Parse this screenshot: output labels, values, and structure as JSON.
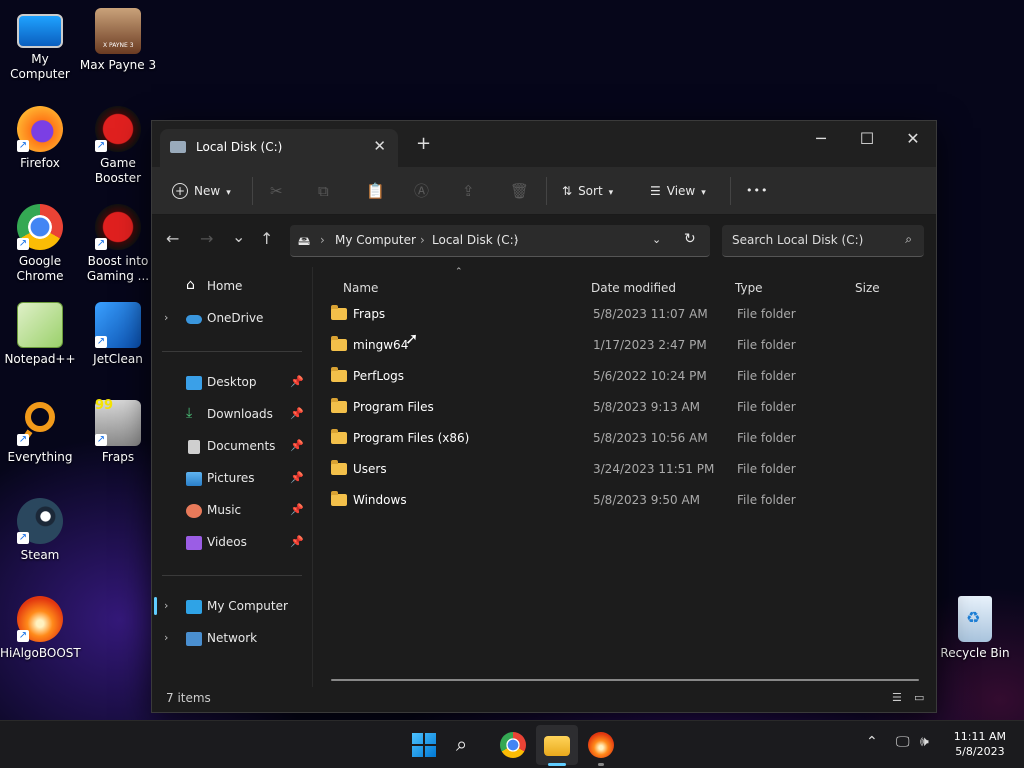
{
  "desktop": {
    "icons": [
      {
        "label": "My Computer",
        "icon": "monitor-icon"
      },
      {
        "label": "Max Payne 3",
        "icon": "game-cover-icon"
      },
      {
        "label": "Firefox",
        "icon": "firefox-icon"
      },
      {
        "label": "Game Booster",
        "icon": "game-booster-icon"
      },
      {
        "label": "Google Chrome",
        "icon": "chrome-icon"
      },
      {
        "label": "Boost into Gaming ...",
        "icon": "game-booster-icon"
      },
      {
        "label": "Notepad++",
        "icon": "notepad-icon"
      },
      {
        "label": "JetClean",
        "icon": "jetclean-icon"
      },
      {
        "label": "Everything",
        "icon": "search-icon"
      },
      {
        "label": "Fraps",
        "icon": "fraps-icon"
      },
      {
        "label": "Steam",
        "icon": "steam-icon"
      },
      {
        "label": "HiAlgoBOOST",
        "icon": "flame-icon"
      },
      {
        "label": "Recycle Bin",
        "icon": "recycle-bin-icon"
      }
    ],
    "max_payne_badge": "X PAYNE 3",
    "fraps_badge": "99"
  },
  "window": {
    "tab_title": "Local Disk (C:)",
    "tab_close": "✕",
    "new_tab": "+",
    "minimize": "─",
    "maximize": "☐",
    "close": "✕"
  },
  "toolbar": {
    "new_label": "New",
    "sort_label": "Sort",
    "view_label": "View",
    "more": "•••"
  },
  "nav": {
    "back": "←",
    "forward": "→",
    "recent": "⌄",
    "up": "↑",
    "breadcrumb": [
      "My Computer",
      "Local Disk (C:)"
    ],
    "search_placeholder": "Search Local Disk (C:)"
  },
  "sidebar": {
    "home": "Home",
    "onedrive": "OneDrive",
    "quick": [
      "Desktop",
      "Downloads",
      "Documents",
      "Pictures",
      "Music",
      "Videos"
    ],
    "my_computer": "My Computer",
    "network": "Network"
  },
  "columns": {
    "name": "Name",
    "date": "Date modified",
    "type": "Type",
    "size": "Size"
  },
  "files": [
    {
      "name": "Fraps",
      "date": "5/8/2023 11:07 AM",
      "type": "File folder"
    },
    {
      "name": "mingw64",
      "date": "1/17/2023 2:47 PM",
      "type": "File folder"
    },
    {
      "name": "PerfLogs",
      "date": "5/6/2022 10:24 PM",
      "type": "File folder"
    },
    {
      "name": "Program Files",
      "date": "5/8/2023 9:13 AM",
      "type": "File folder"
    },
    {
      "name": "Program Files (x86)",
      "date": "5/8/2023 10:56 AM",
      "type": "File folder"
    },
    {
      "name": "Users",
      "date": "3/24/2023 11:51 PM",
      "type": "File folder"
    },
    {
      "name": "Windows",
      "date": "5/8/2023 9:50 AM",
      "type": "File folder"
    }
  ],
  "status": {
    "count": "7 items"
  },
  "taskbar": {
    "time": "11:11 AM",
    "date": "5/8/2023"
  },
  "colors": {
    "accent": "#60cdff",
    "folder": "#f3c04a"
  }
}
